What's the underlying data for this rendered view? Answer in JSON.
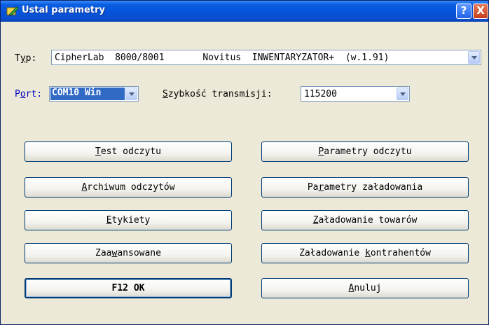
{
  "window": {
    "title": "Ustal parametry",
    "help": "?",
    "close": "X"
  },
  "typ": {
    "label": "Typ:",
    "value": "CipherLab  8000/8001       Novitus  INWENTARYZATOR+  (w.1.91)"
  },
  "port": {
    "label": "Port:",
    "value": "COM10 Win"
  },
  "speed": {
    "label": "Szybkość transmisji:",
    "value": "115200"
  },
  "buttons": {
    "test": "Test odczytu",
    "param_odczytu": "Parametry odczytu",
    "archiwum": "Archiwum odczytów",
    "param_zaladowania": "Parametry załadowania",
    "etykiety": "Etykiety",
    "zal_towarow": "Załadowanie towarów",
    "zaawansowane": "Zaawansowane",
    "zal_kontrahentow": "Załadowanie kontrahentów",
    "ok": "F12 OK",
    "anuluj": "Anuluj"
  }
}
